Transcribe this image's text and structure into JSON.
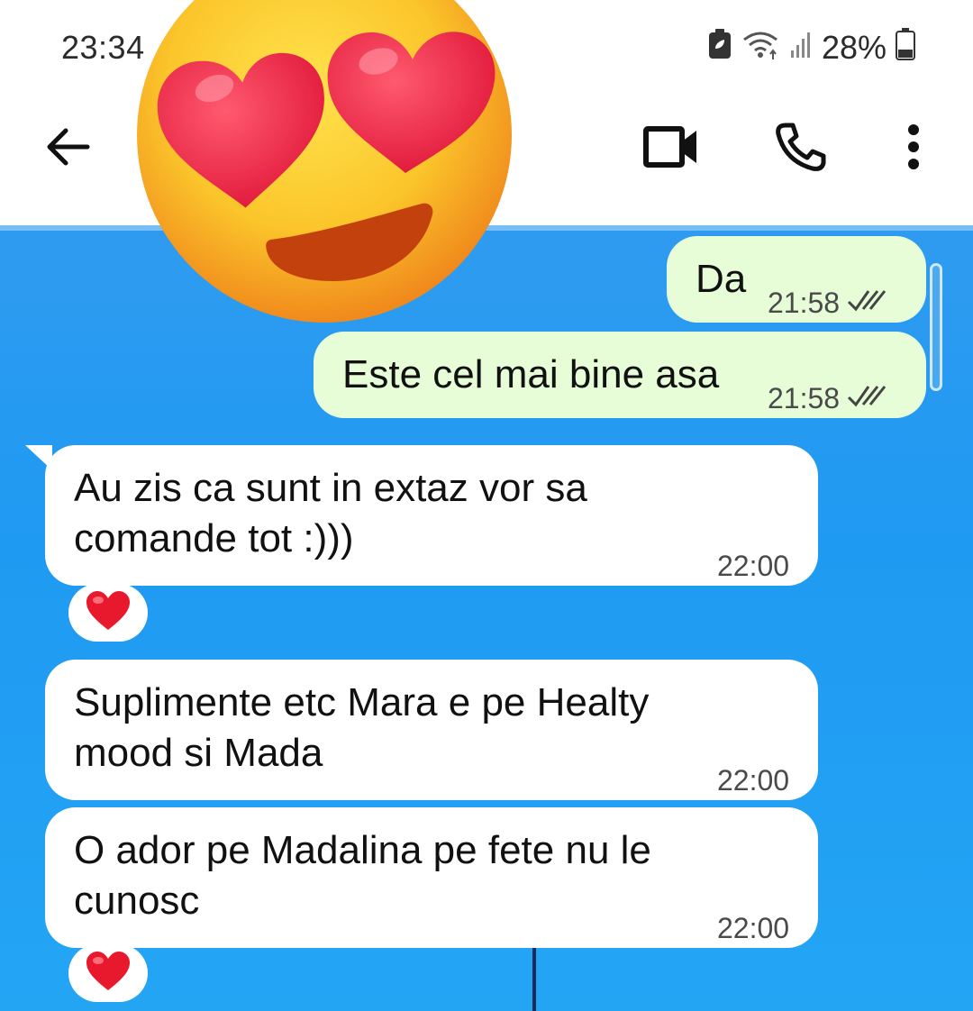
{
  "status_bar": {
    "time": "23:34",
    "battery": "28%",
    "icons": [
      "battery-saver-icon",
      "wifi-icon",
      "signal-icon",
      "battery-icon"
    ]
  },
  "header": {
    "back_icon": "back-arrow-icon",
    "video_icon": "video-call-icon",
    "call_icon": "phone-icon",
    "menu_icon": "more-vert-icon"
  },
  "overlay": {
    "emoji": "heart-eyes-emoji"
  },
  "messages": [
    {
      "direction": "out",
      "text": "Da",
      "time": "21:58",
      "status": "read"
    },
    {
      "direction": "out",
      "text": "Este cel mai bine asa",
      "time": "21:58",
      "status": "read"
    },
    {
      "direction": "in",
      "line1": "Au zis ca sunt in extaz vor sa",
      "line2": "comande tot :)))",
      "time": "22:00",
      "reaction": "heart"
    },
    {
      "direction": "in",
      "line1": "Suplimente etc Mara e pe Healty",
      "line2": "mood si Mada",
      "time": "22:00"
    },
    {
      "direction": "in",
      "line1": "O ador pe Madalina pe fete nu le",
      "line2": "cunosc",
      "time": "22:00",
      "reaction": "heart"
    }
  ],
  "colors": {
    "chat_background": "#2196F3",
    "outgoing_bubble": "#E6FDD8",
    "incoming_bubble": "#FFFFFF",
    "read_ticks": "#444444"
  }
}
